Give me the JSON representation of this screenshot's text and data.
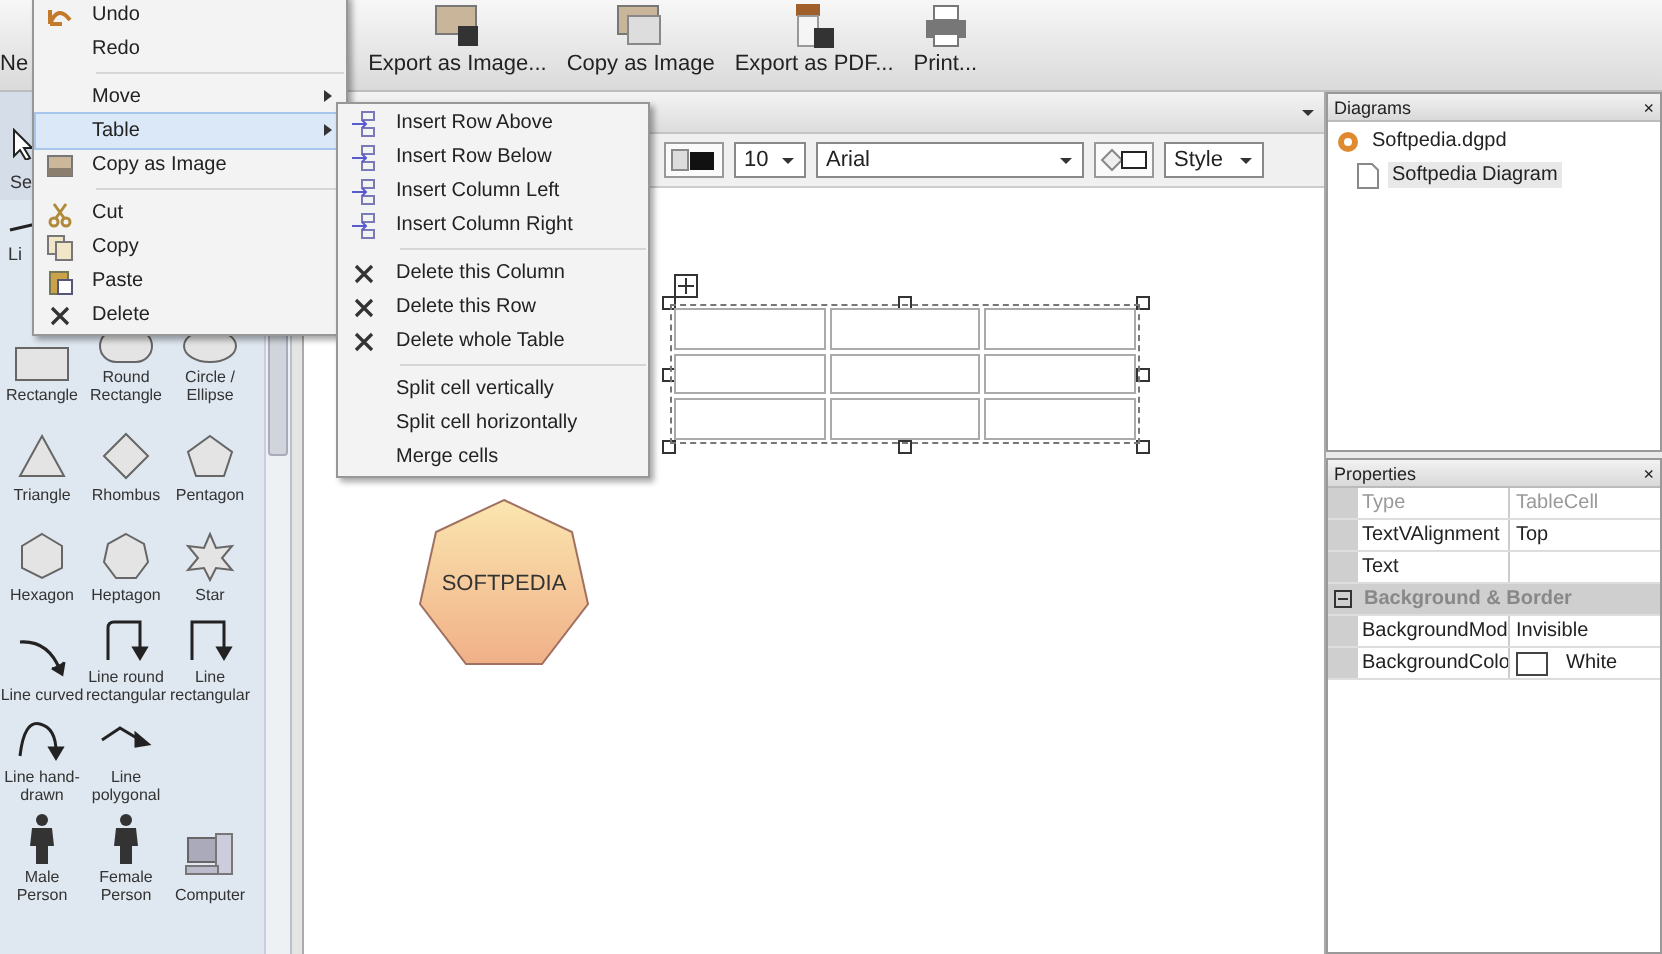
{
  "ribbon": {
    "cut_label": "Ne",
    "buttons": [
      {
        "label": "Export as Image..."
      },
      {
        "label": "Copy as Image"
      },
      {
        "label": "Export as PDF..."
      },
      {
        "label": "Print..."
      }
    ]
  },
  "toolbox": {
    "cut_top": "Se",
    "cut_line": "Li",
    "shapes": [
      {
        "kind": "rectangle",
        "label": "Rectangle"
      },
      {
        "kind": "round-rectangle",
        "label": "Round Rectangle"
      },
      {
        "kind": "ellipse",
        "label": "Circle / Ellipse"
      },
      {
        "kind": "triangle",
        "label": "Triangle"
      },
      {
        "kind": "rhombus",
        "label": "Rhombus"
      },
      {
        "kind": "pentagon",
        "label": "Pentagon"
      },
      {
        "kind": "hexagon",
        "label": "Hexagon"
      },
      {
        "kind": "heptagon",
        "label": "Heptagon"
      },
      {
        "kind": "star",
        "label": "Star"
      },
      {
        "kind": "line-curved",
        "label": "Line curved"
      },
      {
        "kind": "line-round",
        "label": "Line round rectangular"
      },
      {
        "kind": "line-rect",
        "label": "Line rectangular"
      },
      {
        "kind": "line-hand",
        "label": "Line hand-drawn"
      },
      {
        "kind": "line-poly",
        "label": "Line polygonal"
      },
      {
        "kind": "empty"
      },
      {
        "kind": "male",
        "label": "Male Person"
      },
      {
        "kind": "female",
        "label": "Female Person"
      },
      {
        "kind": "computer",
        "label": "Computer"
      }
    ]
  },
  "editor": {
    "toolbar": {
      "font_size": "10",
      "font": "Arial",
      "style": "Style"
    },
    "shape_label": "SOFTPEDIA"
  },
  "diagrams": {
    "title": "Diagrams",
    "close": "×",
    "tree": [
      {
        "label": "Softpedia.dgpd",
        "children": [
          {
            "label": "Softpedia Diagram",
            "selected": true
          }
        ]
      }
    ]
  },
  "properties": {
    "title": "Properties",
    "close": "×",
    "rows": [
      {
        "kind": "property",
        "name": "Type",
        "value": "TableCell",
        "disabled": true
      },
      {
        "kind": "property",
        "name": "TextVAlignment",
        "value": "Top",
        "disabled": false
      },
      {
        "kind": "property",
        "name": "Text",
        "disabled": false
      },
      {
        "kind": "category",
        "name": "Background & Border",
        "expanded": true
      },
      {
        "kind": "property",
        "name": "BackgroundMod",
        "value": "Invisible",
        "disabled": false
      },
      {
        "kind": "color",
        "name": "BackgroundColo",
        "value": "White",
        "disabled": false
      }
    ]
  },
  "context_menu": {
    "items": [
      {
        "kind": "item",
        "label": "Undo",
        "selected": false,
        "submenu": false
      },
      {
        "kind": "item",
        "label": "Redo",
        "selected": false,
        "submenu": false
      },
      {
        "kind": "separator"
      },
      {
        "kind": "item",
        "label": "Move",
        "selected": false,
        "submenu": true
      },
      {
        "kind": "item",
        "label": "Table",
        "selected": true,
        "submenu": true
      },
      {
        "kind": "item",
        "label": "Copy as Image",
        "selected": false,
        "submenu": false
      },
      {
        "kind": "separator"
      },
      {
        "kind": "item",
        "label": "Cut",
        "selected": false,
        "submenu": false
      },
      {
        "kind": "item",
        "label": "Copy",
        "selected": false,
        "submenu": false
      },
      {
        "kind": "item",
        "label": "Paste",
        "selected": false,
        "submenu": false
      },
      {
        "kind": "item",
        "label": "Delete",
        "selected": false,
        "submenu": false
      }
    ]
  },
  "submenu": {
    "groups": [
      [
        "Insert Row Above",
        "Insert Row Below",
        "Insert Column Left",
        "Insert Column Right"
      ],
      [
        "Delete this Column",
        "Delete this Row",
        "Delete whole Table"
      ],
      [
        "Split cell vertically",
        "Split cell horizontally",
        "Merge cells"
      ]
    ]
  }
}
